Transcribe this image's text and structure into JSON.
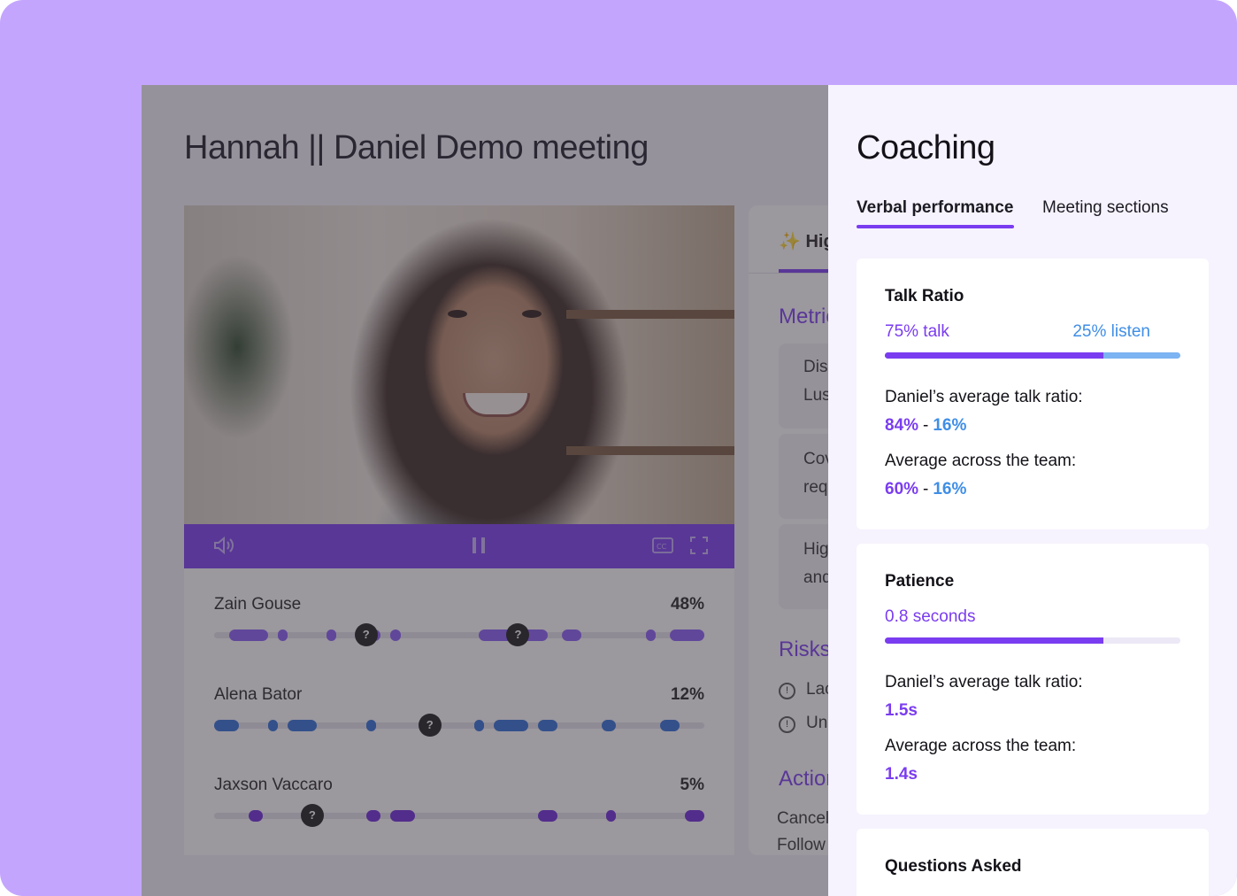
{
  "meeting": {
    "title": "Hannah || Daniel Demo meeting"
  },
  "speakers": [
    {
      "name": "Zain Gouse",
      "percent": "48%",
      "color": "#8b5cf6",
      "segments": [
        [
          0.03,
          0.11
        ],
        [
          0.13,
          0.15
        ],
        [
          0.23,
          0.25
        ],
        [
          0.29,
          0.34
        ],
        [
          0.36,
          0.38
        ],
        [
          0.54,
          0.68
        ],
        [
          0.71,
          0.75
        ],
        [
          0.88,
          0.9
        ],
        [
          0.93,
          1.0
        ]
      ],
      "questions": [
        0.31,
        0.62
      ]
    },
    {
      "name": "Alena Bator",
      "percent": "12%",
      "color": "#2f6fd6",
      "segments": [
        [
          0.0,
          0.05
        ],
        [
          0.11,
          0.13
        ],
        [
          0.15,
          0.21
        ],
        [
          0.31,
          0.33
        ],
        [
          0.53,
          0.55
        ],
        [
          0.57,
          0.64
        ],
        [
          0.66,
          0.7
        ],
        [
          0.79,
          0.82
        ],
        [
          0.91,
          0.95
        ]
      ],
      "questions": [
        0.44
      ]
    },
    {
      "name": "Jaxson Vaccaro",
      "percent": "5%",
      "color": "#6d28d9",
      "segments": [
        [
          0.07,
          0.1
        ],
        [
          0.31,
          0.34
        ],
        [
          0.36,
          0.41
        ],
        [
          0.66,
          0.7
        ],
        [
          0.8,
          0.82
        ],
        [
          0.96,
          1.0
        ]
      ],
      "questions": [
        0.2
      ]
    }
  ],
  "sidebar": {
    "tab_label": "Highlights",
    "metrics_heading": "Metrics",
    "cards": [
      {
        "line1": "Discovery",
        "line2": "Lusha"
      },
      {
        "line1": "Covered",
        "line2": "requirements"
      },
      {
        "line1": "Highlights",
        "line2": "and"
      }
    ],
    "risks_heading": "Risks",
    "risks": [
      "Lack of",
      "Unanswered"
    ],
    "actions_heading": "Actions",
    "actions": [
      "Cancel",
      "Follow"
    ]
  },
  "coaching": {
    "title": "Coaching",
    "tabs": [
      {
        "label": "Verbal performance",
        "active": true
      },
      {
        "label": "Meeting sections",
        "active": false
      }
    ],
    "talk_ratio": {
      "heading": "Talk Ratio",
      "talk_label": "75% talk",
      "listen_label": "25% listen",
      "talk_fraction": 0.74,
      "daniel_label": "Daniel’s average talk ratio:",
      "daniel_talk": "84%",
      "daniel_listen": "16%",
      "team_label": "Average across the team:",
      "team_talk": "60%",
      "team_listen": "16%"
    },
    "patience": {
      "heading": "Patience",
      "value_label": "0.8 seconds",
      "fraction": 0.74,
      "daniel_label": "Daniel’s average talk ratio:",
      "daniel_value": "1.5s",
      "team_label": "Average across the team:",
      "team_value": "1.4s"
    },
    "questions": {
      "heading": "Questions Asked"
    }
  },
  "colors": {
    "accent": "#7a3cf0",
    "listen": "#3f8ee6",
    "background": "#c4a5fd"
  },
  "icons": [
    "volume-icon",
    "pause-icon",
    "closed-captions-icon",
    "fullscreen-icon",
    "sparkle-icon",
    "info-circle-icon",
    "help-icon"
  ]
}
